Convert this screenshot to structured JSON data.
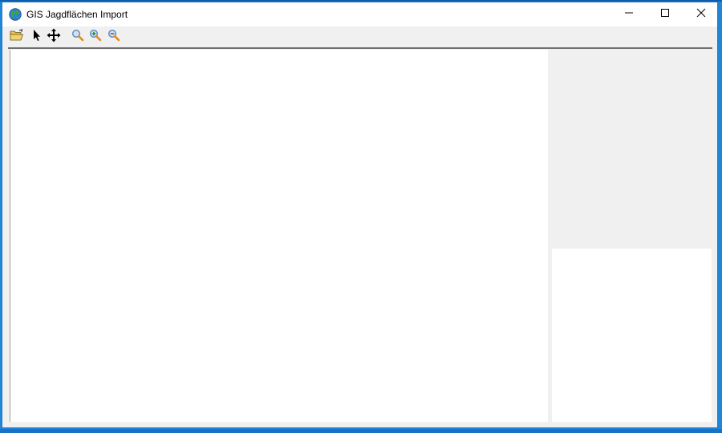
{
  "window": {
    "title": "GIS Jagdflächen Import",
    "app_icon": "globe-icon",
    "controls": [
      {
        "name": "minimize",
        "icon": "minimize-icon"
      },
      {
        "name": "maximize",
        "icon": "maximize-icon"
      },
      {
        "name": "close",
        "icon": "close-icon"
      }
    ]
  },
  "toolbar": {
    "tools": [
      {
        "id": "open",
        "icon": "open-folder-icon"
      },
      {
        "id": "select",
        "icon": "arrow-pointer-icon"
      },
      {
        "id": "pan",
        "icon": "pan-arrows-icon"
      },
      {
        "id": "zoom",
        "icon": "magnifier-icon"
      },
      {
        "id": "zoom-in",
        "icon": "zoom-in-icon"
      },
      {
        "id": "zoom-out",
        "icon": "zoom-out-icon"
      }
    ]
  },
  "colors": {
    "desktop": "#1f86d8",
    "window_border": "#2b79c2",
    "panel_background": "#f0f0f0",
    "canvas_background": "#ffffff"
  }
}
